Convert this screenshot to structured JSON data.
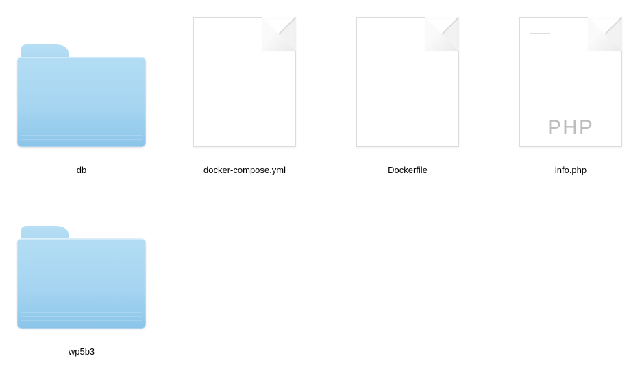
{
  "items": [
    {
      "name": "db",
      "type": "folder",
      "tag": ""
    },
    {
      "name": "docker-compose.yml",
      "type": "file",
      "tag": ""
    },
    {
      "name": "Dockerfile",
      "type": "file",
      "tag": ""
    },
    {
      "name": "info.php",
      "type": "file",
      "tag": "PHP"
    },
    {
      "name": "wp5b3",
      "type": "folder",
      "tag": ""
    }
  ]
}
